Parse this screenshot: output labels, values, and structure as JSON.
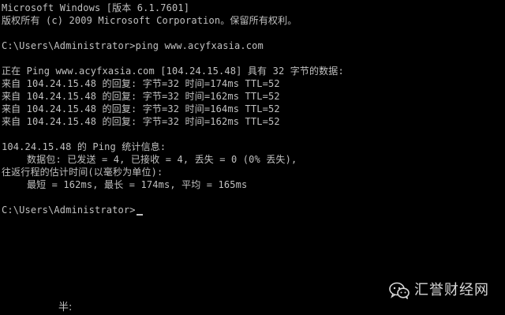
{
  "console": {
    "lines": [
      "Microsoft Windows [版本 6.1.7601]",
      "版权所有 (c) 2009 Microsoft Corporation。保留所有权利。",
      "",
      "C:\\Users\\Administrator>ping www.acyfxasia.com",
      "",
      "正在 Ping www.acyfxasia.com [104.24.15.48] 具有 32 字节的数据:",
      "来自 104.24.15.48 的回复: 字节=32 时间=174ms TTL=52",
      "来自 104.24.15.48 的回复: 字节=32 时间=162ms TTL=52",
      "来自 104.24.15.48 的回复: 字节=32 时间=164ms TTL=52",
      "来自 104.24.15.48 的回复: 字节=32 时间=162ms TTL=52",
      "",
      "104.24.15.48 的 Ping 统计信息:",
      "数据包: 已发送 = 4, 已接收 = 4, 丢失 = 0 (0% 丢失),",
      "往返行程的估计时间(以毫秒为单位):",
      "最短 = 162ms, 最长 = 174ms, 平均 = 165ms",
      "",
      "C:\\Users\\Administrator>"
    ]
  },
  "watermark": {
    "text": "汇誉财经网",
    "icon": "wechat-icon"
  },
  "bottom_fragment": "半:",
  "colors": {
    "background": "#000000",
    "text": "#c0c0c0"
  }
}
